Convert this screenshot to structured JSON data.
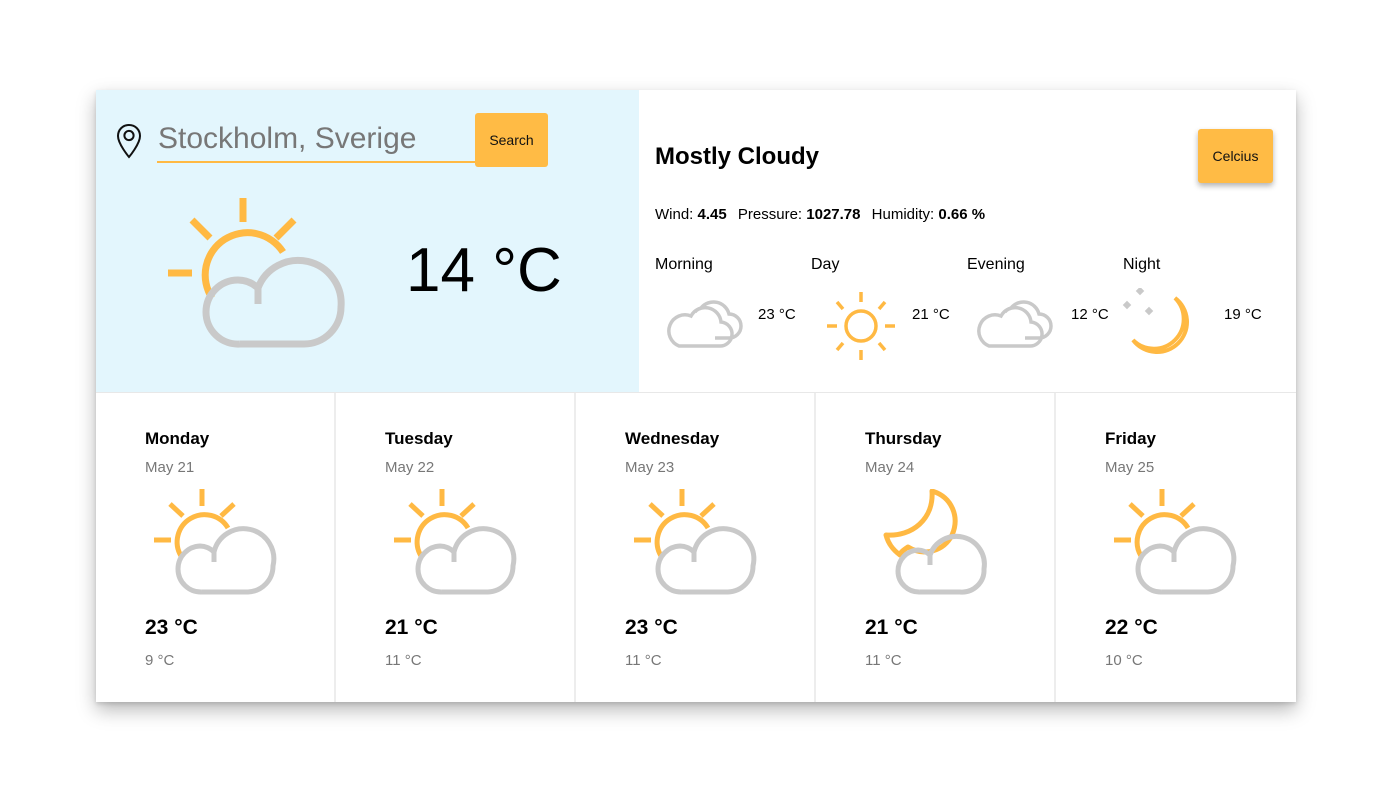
{
  "search": {
    "value": "Stockholm, Sverige",
    "button_label": "Search",
    "icon": "map-pin-icon"
  },
  "current": {
    "temperature": "14 °C",
    "icon": "partly-cloudy-day-icon",
    "condition": "Mostly Cloudy",
    "unit_button_label": "Celcius",
    "wind_label": "Wind:",
    "wind_value": "4.45",
    "pressure_label": "Pressure:",
    "pressure_value": "1027.78",
    "humidity_label": "Humidity:",
    "humidity_value": "0.66 %"
  },
  "periods": [
    {
      "label": "Morning",
      "icon": "cloudy-icon",
      "temp": "23 °C"
    },
    {
      "label": "Day",
      "icon": "sun-icon",
      "temp": "21 °C"
    },
    {
      "label": "Evening",
      "icon": "cloudy-icon",
      "temp": "12 °C"
    },
    {
      "label": "Night",
      "icon": "moon-stars-icon",
      "temp": "19 °C"
    }
  ],
  "forecast": [
    {
      "day": "Monday",
      "date": "May 21",
      "icon": "partly-cloudy-day-icon",
      "high": "23 °C",
      "low": "9 °C"
    },
    {
      "day": "Tuesday",
      "date": "May 22",
      "icon": "partly-cloudy-day-icon",
      "high": "21 °C",
      "low": "11 °C"
    },
    {
      "day": "Wednesday",
      "date": "May 23",
      "icon": "partly-cloudy-day-icon",
      "high": "23 °C",
      "low": "11 °C"
    },
    {
      "day": "Thursday",
      "date": "May 24",
      "icon": "partly-cloudy-night-icon",
      "high": "21 °C",
      "low": "11 °C"
    },
    {
      "day": "Friday",
      "date": "May 25",
      "icon": "partly-cloudy-day-icon",
      "high": "22 °C",
      "low": "10 °C"
    }
  ],
  "colors": {
    "accent": "#ffbb45",
    "sun": "#ffb943",
    "cloud": "#c9c9c9",
    "current_panel_bg": "#e3f6fd"
  }
}
